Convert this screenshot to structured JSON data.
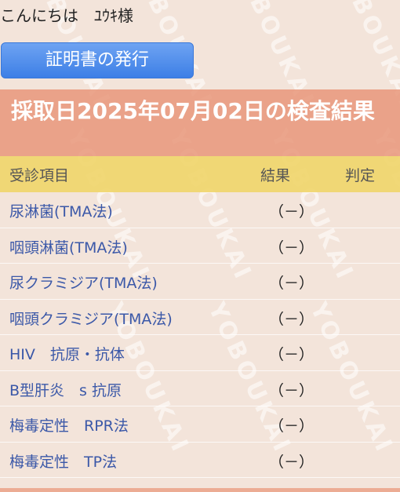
{
  "greeting": "こんにちは　ﾕｳｷ様",
  "certificate_button_label": "証明書の発行",
  "result_heading": "採取日2025年07月02日の検査結果",
  "watermark_text": "YOBOUKAI",
  "table": {
    "headers": {
      "item": "受診項目",
      "result": "結果",
      "judgment": "判定"
    },
    "rows": [
      {
        "item": "尿淋菌(TMA法)",
        "result": "（－）",
        "judgment": ""
      },
      {
        "item": "咽頭淋菌(TMA法)",
        "result": "（－）",
        "judgment": ""
      },
      {
        "item": "尿クラミジア(TMA法)",
        "result": "（－）",
        "judgment": ""
      },
      {
        "item": "咽頭クラミジア(TMA法)",
        "result": "（－）",
        "judgment": ""
      },
      {
        "item": "HIV　抗原・抗体",
        "result": "（－）",
        "judgment": ""
      },
      {
        "item": "B型肝炎　s 抗原",
        "result": "（－）",
        "judgment": ""
      },
      {
        "item": "梅毒定性　RPR法",
        "result": "（－）",
        "judgment": ""
      },
      {
        "item": "梅毒定性　TP法",
        "result": "（－）",
        "judgment": ""
      }
    ]
  },
  "colors": {
    "background": "#f3e4da",
    "title_band": "#e89476",
    "header_band": "#f0d66c",
    "button": "#4a8aea",
    "item_text": "#3b58a8"
  }
}
